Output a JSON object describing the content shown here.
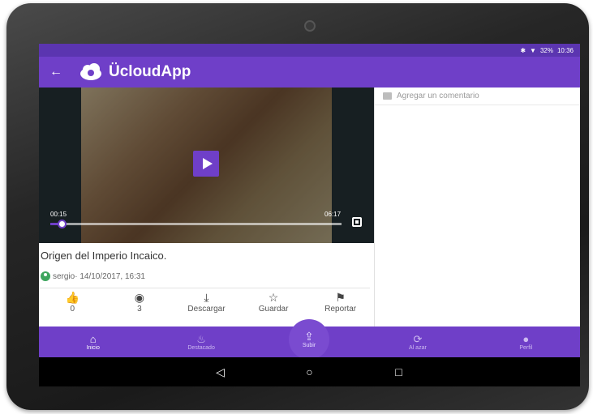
{
  "status": {
    "bluetooth": "✱",
    "wifi": "▼",
    "battery": "32%",
    "time": "10:36"
  },
  "appbar": {
    "back_icon": "arrow-left-icon",
    "title": "ÜcloudApp"
  },
  "video": {
    "current_time": "00:15",
    "duration": "06:17",
    "progress_fraction": 0.04
  },
  "post": {
    "title": "Origen del Imperio Incaico.",
    "meta": "sergio· 14/10/2017, 16:31"
  },
  "actions": [
    {
      "icon": "thumbs-up-icon",
      "glyph": "👍",
      "label": "0"
    },
    {
      "icon": "eye-icon",
      "glyph": "◉",
      "label": "3"
    },
    {
      "icon": "download-icon",
      "glyph": "⤓",
      "label": "Descargar"
    },
    {
      "icon": "star-icon",
      "glyph": "☆",
      "label": "Guardar"
    },
    {
      "icon": "flag-icon",
      "glyph": "⚑",
      "label": "Reportar"
    }
  ],
  "comments": {
    "placeholder": "Agregar un comentario"
  },
  "bottom_nav": {
    "items": [
      {
        "icon": "home-icon",
        "glyph": "⌂",
        "label": "Inicio"
      },
      {
        "icon": "flame-icon",
        "glyph": "ὒ5",
        "label": "Destacado"
      },
      {
        "icon": "shuffle-icon",
        "glyph": "⟳",
        "label": "Al azar"
      },
      {
        "icon": "person-icon",
        "glyph": "👤",
        "label": "Perfil"
      }
    ],
    "upload": {
      "icon": "upload-icon",
      "glyph": "⇪",
      "label": "Subir"
    }
  },
  "system_nav": {
    "back": "◁",
    "home": "○",
    "recents": "□"
  },
  "colors": {
    "primary": "#6f3fc8",
    "statusbar": "#5b35b0"
  }
}
